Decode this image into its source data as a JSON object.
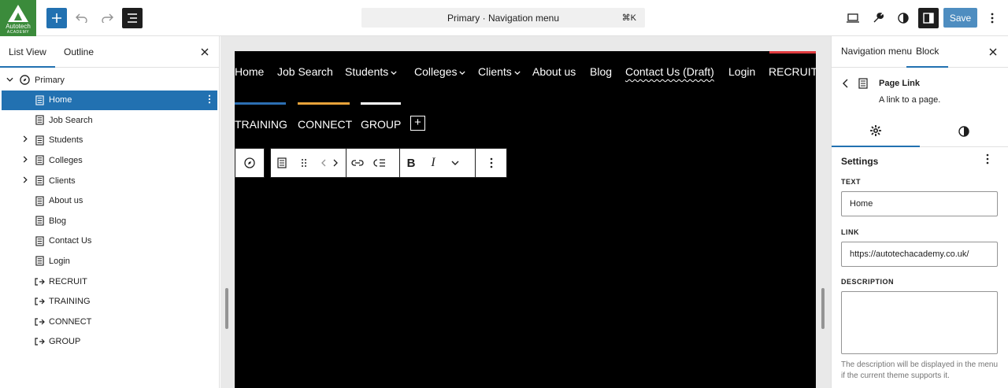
{
  "logo": {
    "line1": "Autotech",
    "line2": "ACADEMY"
  },
  "header": {
    "command_title": "Primary · Navigation menu",
    "shortcut": "⌘K",
    "save_label": "Save"
  },
  "left_panel": {
    "tabs": [
      "List View",
      "Outline"
    ],
    "tree": [
      {
        "label": "Primary",
        "expanded": true,
        "icon": "compass-icon"
      },
      {
        "label": "Home",
        "selected": true,
        "icon": "page-icon"
      },
      {
        "label": "Job Search",
        "icon": "page-icon"
      },
      {
        "label": "Students",
        "has_children": true,
        "icon": "page-icon"
      },
      {
        "label": "Colleges",
        "has_children": true,
        "icon": "page-icon"
      },
      {
        "label": "Clients",
        "has_children": true,
        "icon": "page-icon"
      },
      {
        "label": "About us",
        "icon": "page-icon"
      },
      {
        "label": "Blog",
        "icon": "page-icon"
      },
      {
        "label": "Contact Us",
        "icon": "page-icon"
      },
      {
        "label": "Login",
        "icon": "page-icon"
      },
      {
        "label": "RECRUIT",
        "icon": "link-block-icon"
      },
      {
        "label": "TRAINING",
        "icon": "link-block-icon"
      },
      {
        "label": "CONNECT",
        "icon": "link-block-icon"
      },
      {
        "label": "GROUP",
        "icon": "link-block-icon"
      }
    ]
  },
  "canvas": {
    "nav_row1": [
      "Home",
      "Job Search",
      "Students",
      "Colleges",
      "Clients",
      "About us",
      "Blog",
      "Contact Us (Draft)",
      "Login",
      "RECRUIT"
    ],
    "nav_row2": [
      "TRAINING",
      "CONNECT",
      "GROUP"
    ],
    "colors": {
      "recruit_bar": "#e03a3e",
      "training_bar": "#2c6fb3",
      "connect_bar": "#e8a33a",
      "group_bar": "#ffffff"
    }
  },
  "right_panel": {
    "tabs": [
      "Navigation menu",
      "Block"
    ],
    "block_title": "Page Link",
    "block_desc": "A link to a page.",
    "settings_title": "Settings",
    "text_label": "TEXT",
    "text_value": "Home",
    "link_label": "LINK",
    "link_value": "https://autotechacademy.co.uk/",
    "description_label": "DESCRIPTION",
    "description_value": "",
    "help_text": "The description will be displayed in the menu if the current theme supports it."
  }
}
